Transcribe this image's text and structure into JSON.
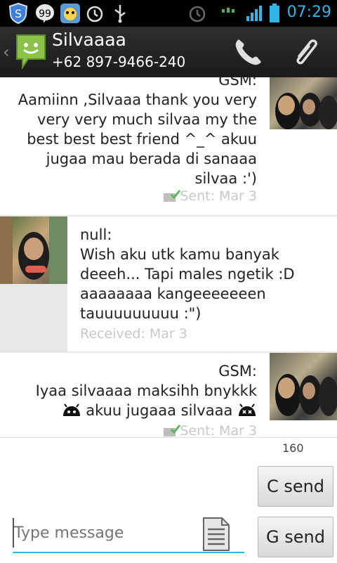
{
  "status_bar": {
    "time": "07:29",
    "icons": [
      "shield-icon",
      "hangouts-icon",
      "app-icon",
      "alarm-icon",
      "usb-icon",
      "alarm-icon",
      "data-icon",
      "signal-icon",
      "battery-icon"
    ],
    "accent_color": "#33b5e5"
  },
  "action_bar": {
    "contact_name": "Silvaaaa",
    "phone_number": "+62 897-9466-240",
    "icons": [
      "back-chevron-icon",
      "messaging-app-icon",
      "phone-icon",
      "attachment-icon"
    ]
  },
  "messages": [
    {
      "direction": "sent",
      "header": "GSM:",
      "body": [
        "Aamiinn ,Silvaaa thank you very",
        "very very much silvaa my the",
        "best best best friend ^_^  akuu",
        "jugaa mau berada di sanaaa",
        "silvaa :')"
      ],
      "status": "Sent: Mar 3"
    },
    {
      "direction": "received",
      "header": "null:",
      "body": [
        "Wish aku utk kamu banyak",
        "deeeh... Tapi males ngetik :D",
        "aaaaaaaa kangeeeeeeen",
        "tauuuuuuuuu :\")"
      ],
      "status": "Received: Mar 3"
    },
    {
      "direction": "sent",
      "header": "GSM:",
      "body": [
        "Iyaa silvaaaa maksihh bnykkk",
        "akuu jugaaa silvaaa"
      ],
      "status": "Sent: Mar 3"
    }
  ],
  "composer": {
    "char_count": "160",
    "placeholder": "Type message",
    "buttons": [
      "C send",
      "G send"
    ]
  }
}
